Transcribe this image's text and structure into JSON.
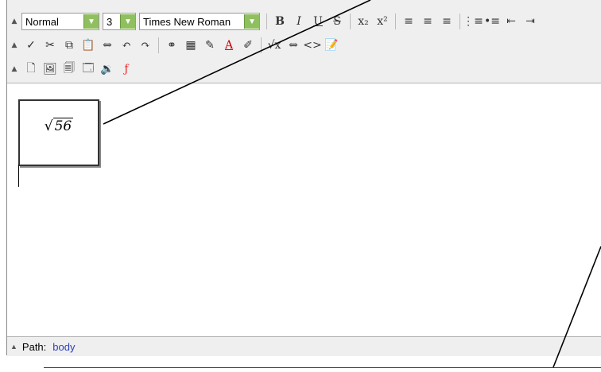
{
  "toolbar": {
    "format_select": "Normal",
    "size_select": "3",
    "font_select": "Times New Roman",
    "row1_buttons": [
      {
        "name": "bold-icon",
        "glyph": "B"
      },
      {
        "name": "italic-icon",
        "glyph": "I"
      },
      {
        "name": "underline-icon",
        "glyph": "U"
      },
      {
        "name": "strikethrough-icon",
        "glyph": "S"
      },
      {
        "name": "subscript-icon",
        "glyph": "x₂"
      },
      {
        "name": "superscript-icon",
        "glyph": "x²"
      },
      {
        "name": "align-left-icon",
        "glyph": "≡"
      },
      {
        "name": "align-center-icon",
        "glyph": "≡"
      },
      {
        "name": "align-right-icon",
        "glyph": "≡"
      },
      {
        "name": "ordered-list-icon",
        "glyph": "⋮≡"
      },
      {
        "name": "unordered-list-icon",
        "glyph": "•≡"
      },
      {
        "name": "outdent-icon",
        "glyph": "⇤"
      },
      {
        "name": "indent-icon",
        "glyph": "⇥"
      }
    ],
    "row2_buttons": [
      {
        "name": "spellcheck-icon",
        "glyph": "✓"
      },
      {
        "name": "cut-icon",
        "glyph": "✂"
      },
      {
        "name": "copy-icon",
        "glyph": "⧉"
      },
      {
        "name": "paste-icon",
        "glyph": "📋"
      },
      {
        "name": "find-replace-icon",
        "glyph": "⇔"
      },
      {
        "name": "undo-icon",
        "glyph": "↶"
      },
      {
        "name": "redo-icon",
        "glyph": "↷"
      },
      {
        "name": "insert-link-icon",
        "glyph": "⚭"
      },
      {
        "name": "insert-table-icon",
        "glyph": "▦"
      },
      {
        "name": "pencil-icon",
        "glyph": "✎"
      },
      {
        "name": "font-color-icon",
        "glyph": "A"
      },
      {
        "name": "highlight-icon",
        "glyph": "✐"
      },
      {
        "name": "equation-icon",
        "glyph": "√x"
      },
      {
        "name": "special-char-icon",
        "glyph": "⇔"
      },
      {
        "name": "source-code-icon",
        "glyph": "<>"
      },
      {
        "name": "edit-icon",
        "glyph": "📝"
      }
    ],
    "row3_buttons": [
      {
        "name": "insert-file-icon",
        "glyph": "🗋"
      },
      {
        "name": "insert-image-icon",
        "glyph": "🖼"
      },
      {
        "name": "insert-document-icon",
        "glyph": "🗐"
      },
      {
        "name": "insert-media-icon",
        "glyph": "🗔"
      },
      {
        "name": "insert-audio-icon",
        "glyph": "🔉"
      },
      {
        "name": "flash-icon",
        "glyph": "ƒ"
      }
    ]
  },
  "editor": {
    "math_radical": "√",
    "math_radicand": "56"
  },
  "statusbar": {
    "path_label": "Path:",
    "path_value": "body"
  }
}
